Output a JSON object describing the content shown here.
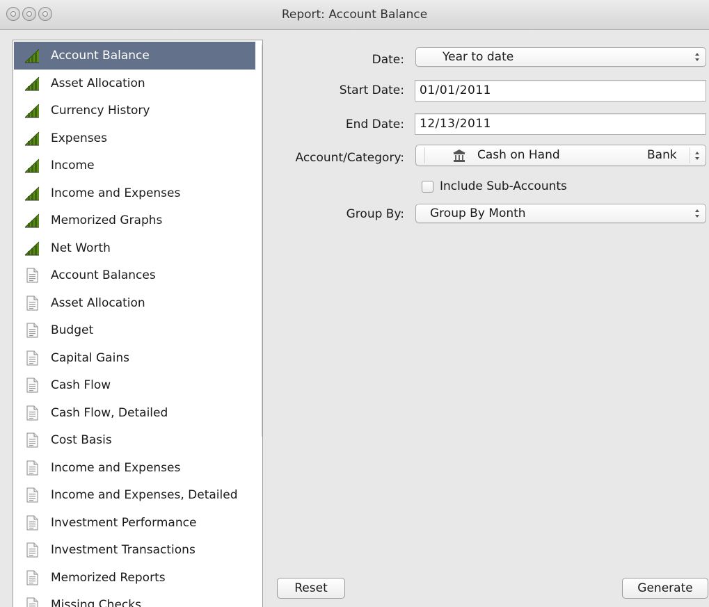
{
  "window": {
    "title": "Report: Account Balance"
  },
  "report_list": {
    "selected_index": 0,
    "items": [
      {
        "label": "Account Balance",
        "icon": "graph-icon"
      },
      {
        "label": "Asset Allocation",
        "icon": "graph-icon"
      },
      {
        "label": "Currency History",
        "icon": "graph-icon"
      },
      {
        "label": "Expenses",
        "icon": "graph-icon"
      },
      {
        "label": "Income",
        "icon": "graph-icon"
      },
      {
        "label": "Income and Expenses",
        "icon": "graph-icon"
      },
      {
        "label": "Memorized Graphs",
        "icon": "graph-icon"
      },
      {
        "label": "Net Worth",
        "icon": "graph-icon"
      },
      {
        "label": "Account Balances",
        "icon": "report-document-icon"
      },
      {
        "label": "Asset Allocation",
        "icon": "report-document-icon"
      },
      {
        "label": "Budget",
        "icon": "report-document-icon"
      },
      {
        "label": "Capital Gains",
        "icon": "report-document-icon"
      },
      {
        "label": "Cash Flow",
        "icon": "report-document-icon"
      },
      {
        "label": "Cash Flow, Detailed",
        "icon": "report-document-icon"
      },
      {
        "label": "Cost Basis",
        "icon": "report-document-icon"
      },
      {
        "label": "Income and Expenses",
        "icon": "report-document-icon"
      },
      {
        "label": "Income and Expenses, Detailed",
        "icon": "report-document-icon"
      },
      {
        "label": "Investment Performance",
        "icon": "report-document-icon"
      },
      {
        "label": "Investment Transactions",
        "icon": "report-document-icon"
      },
      {
        "label": "Memorized Reports",
        "icon": "report-document-icon"
      },
      {
        "label": "Missing Checks",
        "icon": "report-document-icon"
      }
    ]
  },
  "form": {
    "date_label": "Date:",
    "date_value": "Year to date",
    "start_date_label": "Start Date:",
    "start_date_value": "01/01/2011",
    "end_date_label": "End Date:",
    "end_date_value": "12/13/2011",
    "account_label": "Account/Category:",
    "account_value": "Cash on Hand",
    "account_type": "Bank",
    "account_icon": "bank-icon",
    "include_sub_label": "Include Sub-Accounts",
    "include_sub_checked": false,
    "group_by_label": "Group By:",
    "group_by_value": "Group By Month"
  },
  "buttons": {
    "reset": "Reset",
    "generate": "Generate"
  },
  "colors": {
    "selection": "#64718b",
    "window_bg": "#e8e8e8",
    "graph_icon_green": "#4f7a14"
  }
}
